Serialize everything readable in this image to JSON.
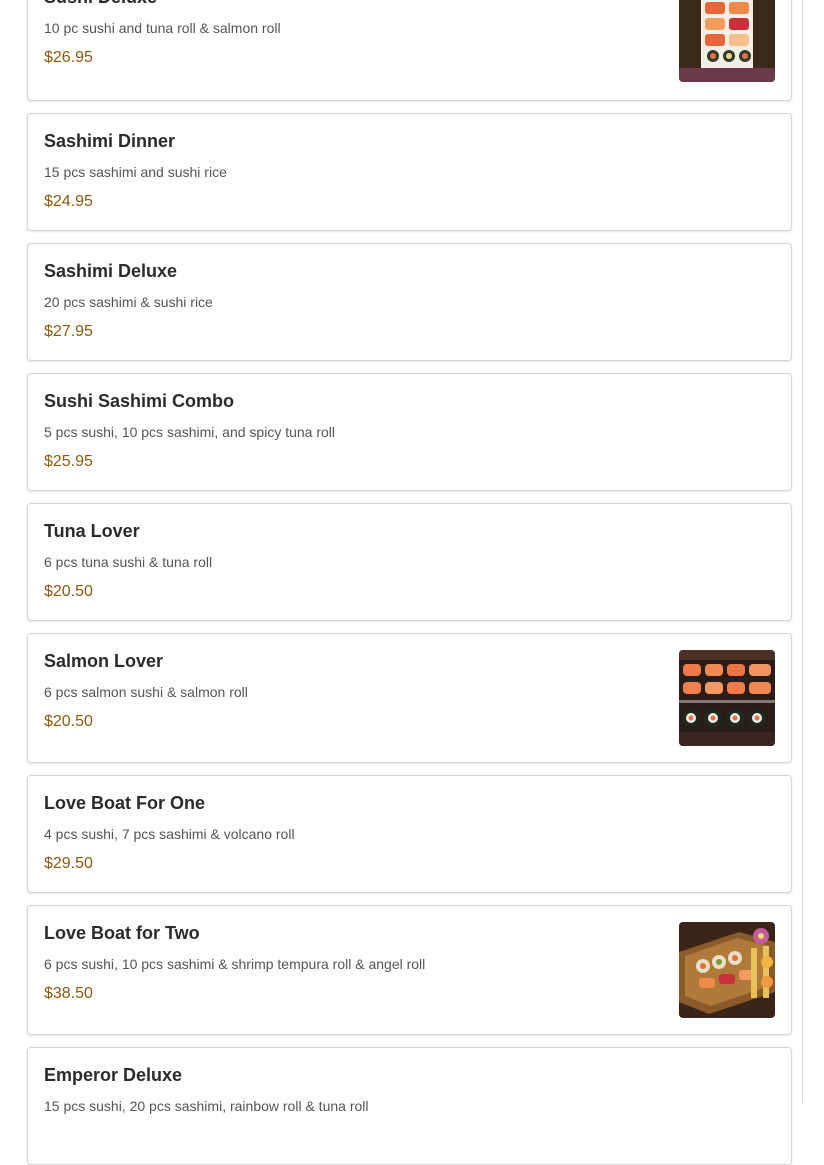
{
  "menu": {
    "items": [
      {
        "name": "Sushi Deluxe",
        "description": "10 pc sushi and tuna roll & salmon roll",
        "price": "$26.95",
        "image": "sushi-boat-photo"
      },
      {
        "name": "Sashimi Dinner",
        "description": "15 pcs sashimi and sushi rice",
        "price": "$24.95"
      },
      {
        "name": "Sashimi Deluxe",
        "description": "20 pcs sashimi & sushi rice",
        "price": "$27.95"
      },
      {
        "name": "Sushi Sashimi Combo",
        "description": "5 pcs sushi, 10 pcs sashimi, and spicy tuna roll",
        "price": "$25.95"
      },
      {
        "name": "Tuna Lover",
        "description": "6 pcs tuna sushi & tuna roll",
        "price": "$20.50"
      },
      {
        "name": "Salmon Lover",
        "description": "6 pcs salmon sushi & salmon roll",
        "price": "$20.50",
        "image": "salmon-sushi-photo"
      },
      {
        "name": "Love Boat For One",
        "description": "4 pcs sushi, 7 pcs sashimi & volcano roll",
        "price": "$29.50"
      },
      {
        "name": "Love Boat for Two",
        "description": "6 pcs sushi, 10 pcs sashimi & shrimp tempura roll & angel roll",
        "price": "$38.50",
        "image": "love-boat-photo"
      },
      {
        "name": "Emperor Deluxe",
        "description": "15 pcs sushi, 20 pcs sashimi, rainbow roll & tuna roll",
        "price": ""
      }
    ]
  },
  "colors": {
    "price": "#8a5a10",
    "title": "#2b2b2b",
    "description": "#555555",
    "card_border": "#d6d6d6"
  }
}
